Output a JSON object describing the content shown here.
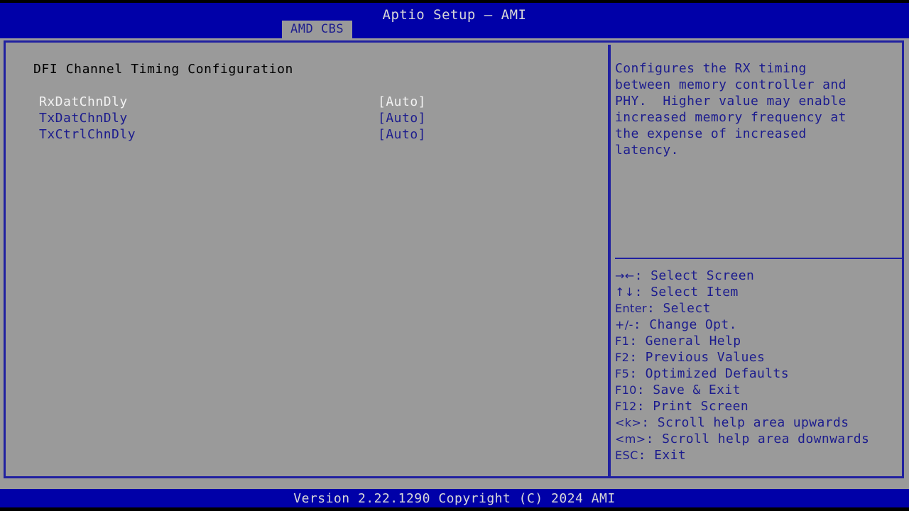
{
  "header": {
    "title": "Aptio Setup – AMI",
    "tabs": [
      {
        "label": "AMD CBS",
        "active": true
      }
    ]
  },
  "main": {
    "section_title": "DFI Channel Timing Configuration",
    "settings": [
      {
        "label": "RxDatChnDly",
        "value": "[Auto]",
        "selected": true
      },
      {
        "label": "TxDatChnDly",
        "value": "[Auto]",
        "selected": false
      },
      {
        "label": "TxCtrlChnDly",
        "value": "[Auto]",
        "selected": false
      }
    ]
  },
  "help": {
    "text": "Configures the RX timing\nbetween memory controller and\nPHY.  Higher value may enable\nincreased memory frequency at\nthe expense of increased\nlatency.",
    "legend": [
      {
        "keys": "→←",
        "sep": ": ",
        "action": "Select Screen"
      },
      {
        "keys": "↑↓",
        "sep": ": ",
        "action": "Select Item"
      },
      {
        "keys": "Enter",
        "sep": ": ",
        "action": "Select"
      },
      {
        "keys": "+/-",
        "sep": ": ",
        "action": "Change Opt."
      },
      {
        "keys": "F1",
        "sep": ": ",
        "action": "General Help"
      },
      {
        "keys": "F2",
        "sep": ": ",
        "action": "Previous Values"
      },
      {
        "keys": "F5",
        "sep": ": ",
        "action": "Optimized Defaults"
      },
      {
        "keys": "F10",
        "sep": ": ",
        "action": "Save & Exit"
      },
      {
        "keys": "F12",
        "sep": ": ",
        "action": "Print Screen"
      },
      {
        "keys": "<k>",
        "sep": ": ",
        "action": "Scroll help area upwards"
      },
      {
        "keys": "<m>",
        "sep": ": ",
        "action": "Scroll help area downwards"
      },
      {
        "keys": "ESC",
        "sep": ": ",
        "action": "Exit"
      }
    ]
  },
  "footer": {
    "version_text": "Version 2.22.1290 Copyright (C) 2024 AMI"
  },
  "colors": {
    "bar_blue": "#0000a8",
    "panel_grey": "#9a9a9a",
    "border_blue": "#2020a0",
    "text_blue": "#1c1c8e",
    "text_selected": "#f2f2f2",
    "text_black": "#000000",
    "bar_text": "#d8d8d8"
  }
}
